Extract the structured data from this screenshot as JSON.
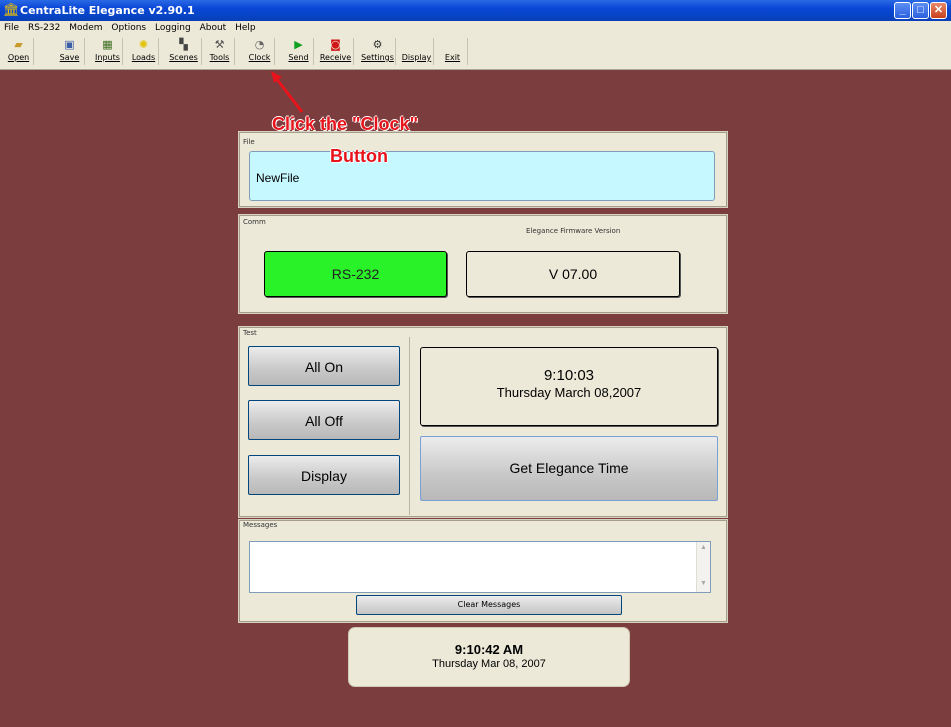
{
  "window": {
    "title": "CentraLite Elegance v2.90.1",
    "min": "_",
    "max": "□",
    "close": "✕"
  },
  "menu": [
    "File",
    "RS-232",
    "Modem",
    "Options",
    "Logging",
    "About",
    "Help"
  ],
  "toolbar": [
    {
      "label": "Open",
      "icon": "folder-open-icon",
      "glyph": "📂"
    },
    {
      "label": "Save",
      "icon": "save-icon",
      "glyph": "💾"
    },
    {
      "label": "Inputs",
      "icon": "inputs-grid-icon",
      "glyph": "▦"
    },
    {
      "label": "Loads",
      "icon": "lightbulb-icon",
      "glyph": "💡"
    },
    {
      "label": "Scenes",
      "icon": "scenes-icon",
      "glyph": "🎬"
    },
    {
      "label": "Tools",
      "icon": "tools-icon",
      "glyph": "🔧"
    },
    {
      "label": "Clock",
      "icon": "clock-icon",
      "glyph": "🕘"
    },
    {
      "label": "Send",
      "icon": "send-arrow-icon",
      "glyph": "▶"
    },
    {
      "label": "Receive",
      "icon": "receive-icon",
      "glyph": "⏺"
    },
    {
      "label": "Settings",
      "icon": "settings-icon",
      "glyph": "⚙"
    },
    {
      "label": "Display",
      "icon": "",
      "glyph": ""
    },
    {
      "label": "Exit",
      "icon": "",
      "glyph": ""
    }
  ],
  "annotation": {
    "line1": "Click the \"Clock\"",
    "line2": "Button",
    "color": "#e8141c"
  },
  "file_group": {
    "title": "File",
    "filename": "NewFile"
  },
  "comm_group": {
    "title": "Comm",
    "firmware_label": "Elegance Firmware Version",
    "port": "RS-232",
    "firmware": "V 07.00"
  },
  "test_group": {
    "title": "Test",
    "all_on": "All On",
    "all_off": "All Off",
    "display": "Display",
    "time": "9:10:03",
    "date": "Thursday  March 08,2007",
    "get_time": "Get Elegance Time"
  },
  "messages_group": {
    "title": "Messages",
    "text": "",
    "clear": "Clear Messages"
  },
  "clock_panel": {
    "time": "9:10:42 AM",
    "date": "Thursday Mar 08, 2007"
  },
  "colors": {
    "background": "#7b3d3d",
    "comm_active": "#29f229",
    "file_field": "#c6f8ff"
  }
}
